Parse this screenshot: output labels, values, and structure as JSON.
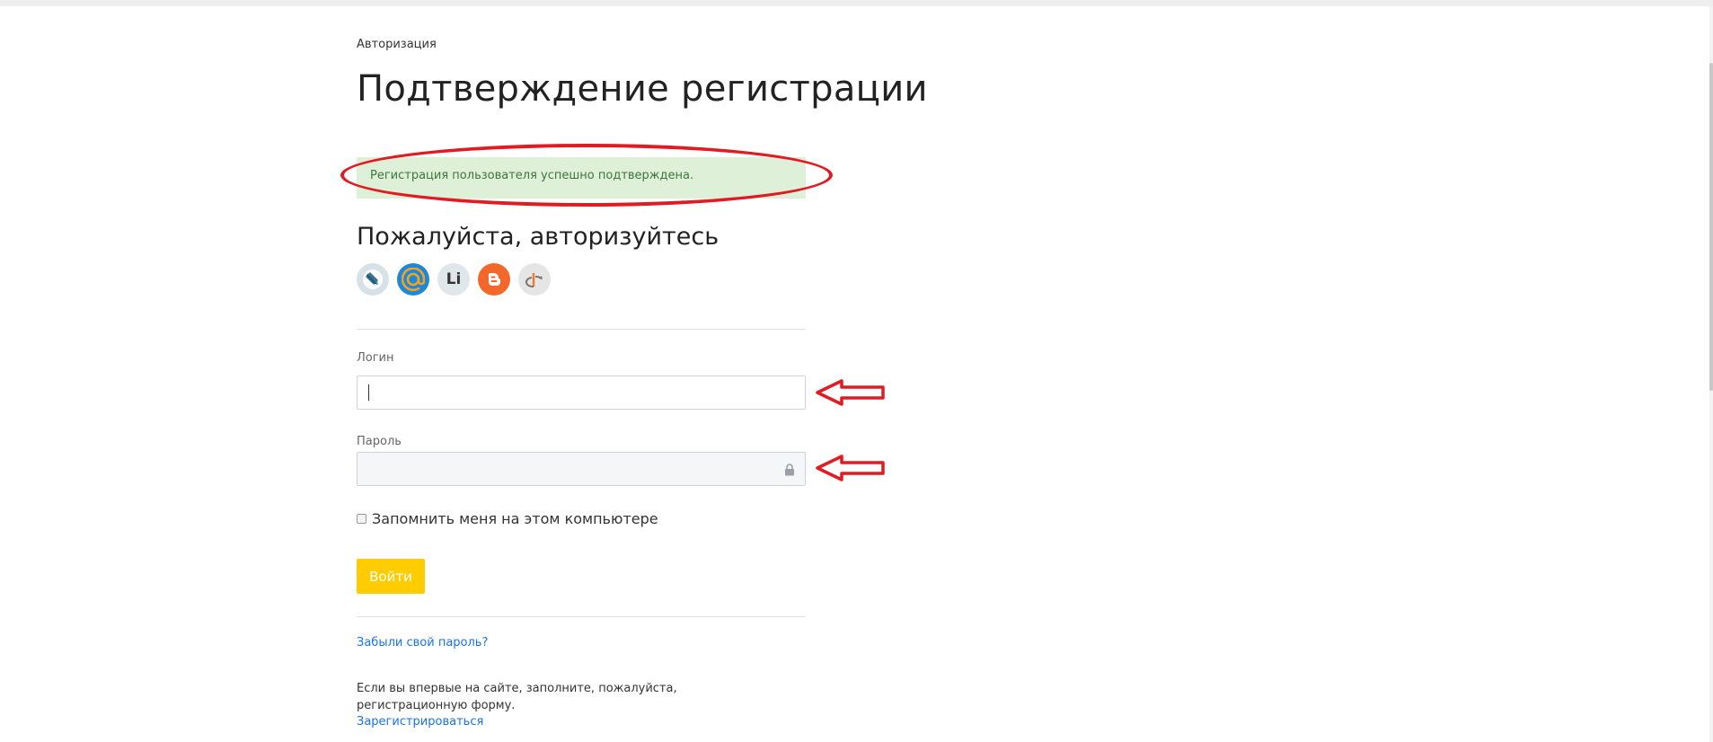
{
  "breadcrumb": "Авторизация",
  "page_title": "Подтверждение регистрации",
  "alert": {
    "text": "Регистрация пользователя успешно подтверждена.",
    "bg_color": "#dff0d8",
    "text_color": "#3c763d"
  },
  "auth": {
    "heading": "Пожалуйста, авторизуйтесь",
    "social_icons": [
      "livejournal-icon",
      "mail-ru-icon",
      "liveinternet-icon",
      "blogger-icon",
      "openid-icon"
    ],
    "liveinternet_glyph": "Li"
  },
  "form": {
    "login_label": "Логин",
    "login_value": "",
    "password_label": "Пароль",
    "password_value": "",
    "remember_label": "Запомнить меня на этом компьютере",
    "remember_checked": false,
    "submit_label": "Войти"
  },
  "links": {
    "forgot_password": "Забыли свой пароль?",
    "register_prompt": "Если вы впервые на сайте, заполните, пожалуйста, регистрационную форму.",
    "register": "Зарегистрироваться"
  },
  "colors": {
    "accent_button": "#ffcc00",
    "link": "#1a73e8",
    "annotation": "#e11b22"
  }
}
